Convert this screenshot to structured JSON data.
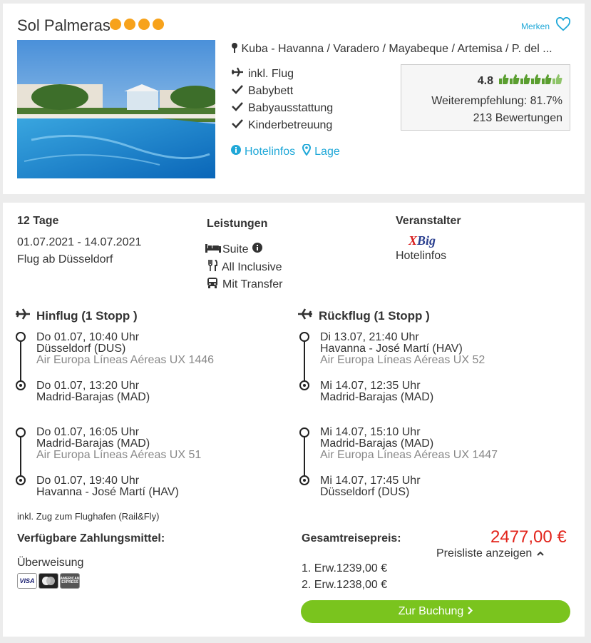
{
  "hotel": {
    "name": "Sol Palmeras",
    "stars": 4,
    "merken_label": "Merken",
    "location": "Kuba - Havanna / Varadero / Mayabeque / Artemisa / P. del ...",
    "features": [
      "inkl. Flug",
      "Babybett",
      "Babyausstattung",
      "Kinderbetreuung"
    ],
    "links": {
      "hotelinfos": "Hotelinfos",
      "lage": "Lage"
    },
    "rating": {
      "score": "4.8",
      "thumbs": 6,
      "recommendation": "Weiterempfehlung: 81.7%",
      "reviews": "213 Bewertungen"
    }
  },
  "offer": {
    "duration": "12 Tage",
    "dates": "01.07.2021 - 14.07.2021",
    "departure": "Flug ab Düsseldorf",
    "leistungen_title": "Leistungen",
    "leistungen": {
      "room": "Suite",
      "board": "All Inclusive",
      "transfer": "Mit Transfer"
    },
    "veranstalter_title": "Veranstalter",
    "veranstalter_logo": {
      "x": "X",
      "big": "Big"
    },
    "veranstalter_link": "Hotelinfos"
  },
  "hinflug": {
    "title": "Hinflug (1 Stopp )",
    "legs": [
      {
        "dep_time": "Do 01.07, 10:40 Uhr",
        "dep_airport": "Düsseldorf (DUS)",
        "airline": "Air Europa Líneas Aéreas UX 1446",
        "arr_time": "Do 01.07, 13:20 Uhr",
        "arr_airport": "Madrid-Barajas (MAD)"
      },
      {
        "dep_time": "Do 01.07, 16:05 Uhr",
        "dep_airport": "Madrid-Barajas (MAD)",
        "airline": "Air Europa Líneas Aéreas UX 51",
        "arr_time": "Do 01.07, 19:40 Uhr",
        "arr_airport": "Havanna - José Martí (HAV)"
      }
    ]
  },
  "rueckflug": {
    "title": "Rückflug (1 Stopp )",
    "legs": [
      {
        "dep_time": "Di 13.07, 21:40 Uhr",
        "dep_airport": "Havanna - José Martí (HAV)",
        "airline": "Air Europa Líneas Aéreas UX 52",
        "arr_time": "Mi 14.07, 12:35 Uhr",
        "arr_airport": "Madrid-Barajas (MAD)"
      },
      {
        "dep_time": "Mi 14.07, 15:10 Uhr",
        "dep_airport": "Madrid-Barajas (MAD)",
        "airline": "Air Europa Líneas Aéreas UX 1447",
        "arr_time": "Mi 14.07, 17:45 Uhr",
        "arr_airport": "Düsseldorf (DUS)"
      }
    ]
  },
  "rail_note": "inkl. Zug zum Flughafen (Rail&Fly)",
  "payment": {
    "title": "Verfügbare Zahlungsmittel:",
    "method": "Überweisung",
    "cards": {
      "visa": "VISA",
      "amex": "AMERICAN EXPRESS"
    }
  },
  "total": {
    "title": "Gesamtreisepreis:",
    "price": "2477,00 €",
    "preisliste": "Preisliste anzeigen",
    "lines": [
      "1. Erw.1239,00 €",
      "2. Erw.1238,00 €"
    ],
    "book_label": "Zur Buchung"
  },
  "colors": {
    "accent": "#20a8d8",
    "price": "#e2231a",
    "book": "#7ac41e",
    "star": "#f7a21b",
    "thumb": "#5a9e2f"
  }
}
